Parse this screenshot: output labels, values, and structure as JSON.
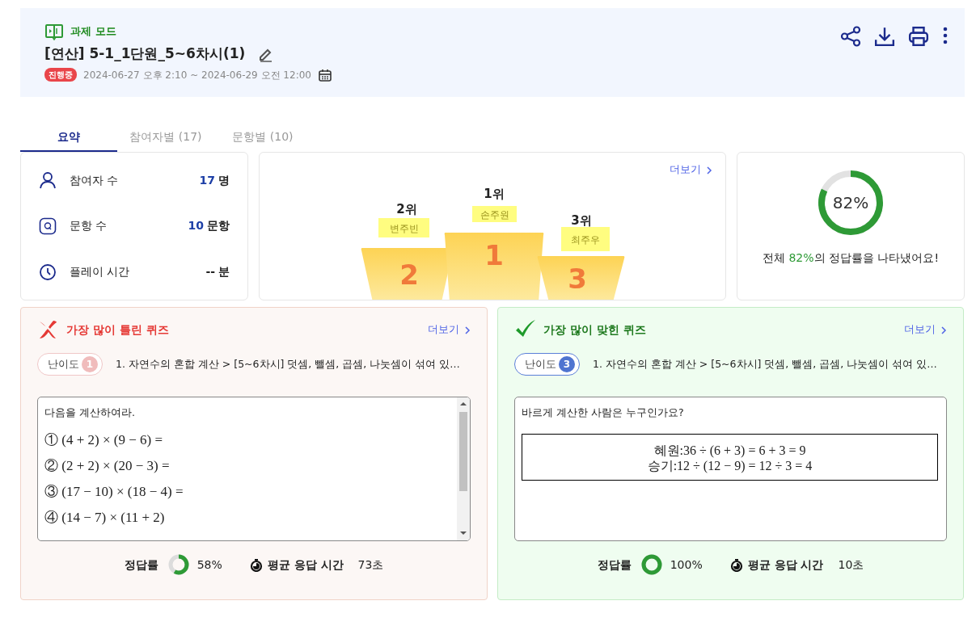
{
  "header": {
    "mode_label": "과제 모드",
    "title": "[연산] 5-1_1단원_5~6차시(1)",
    "status": "진행중",
    "period": "2024-06-27 오후 2:10 ~ 2024-06-29 오전 12:00"
  },
  "tabs": [
    {
      "label": "요약",
      "selected": true
    },
    {
      "label": "참여자별 (17)",
      "selected": false
    },
    {
      "label": "문항별 (10)",
      "selected": false
    }
  ],
  "stats": [
    {
      "kind": "participants",
      "label": "참여자 수",
      "value": "17",
      "unit": "명"
    },
    {
      "kind": "questions",
      "label": "문항 수",
      "value": "10",
      "unit": "문항"
    },
    {
      "kind": "time",
      "label": "플레이 시간",
      "value": "--",
      "unit": "분"
    }
  ],
  "podium": {
    "more_link": "더보기",
    "ranks": [
      {
        "rank_label": "2위",
        "name": "변주빈",
        "number": "2"
      },
      {
        "rank_label": "1위",
        "name": "손주원",
        "number": "1"
      },
      {
        "rank_label": "3위",
        "name": "최주우",
        "number": "3"
      }
    ]
  },
  "overall": {
    "percent": "82%",
    "level": 0.82,
    "caption_before": "전체 ",
    "caption_highlight": "82%",
    "caption_after": "의 정답률을 나타냈어요!"
  },
  "quizzes": [
    {
      "kind": "wrong",
      "title": "가장 많이 틀린 퀴즈",
      "more_link": "더보기",
      "difficulty_label": "난이도",
      "difficulty": "1",
      "path": "1. 자연수의 혼합 계산 > [5~6차시] 덧셈, 뺄셈, 곱셈, 나눗셈이 섞여 있…",
      "question": "다음을 계산하여라.",
      "lines": [
        "① (4 + 2) × (9 − 6) =",
        "② (2 + 2) × (20 − 3) =",
        "③ (17 − 10) × (18 − 4) =",
        "④ (14 − 7) × (11 + 2)"
      ],
      "accuracy_label": "정답률",
      "level": 0.58,
      "accuracy": "58%",
      "time_label": "평균 응답 시간",
      "time": "73초"
    },
    {
      "kind": "right",
      "title": "가장 많이 맞힌 퀴즈",
      "more_link": "더보기",
      "difficulty_label": "난이도",
      "difficulty": "3",
      "path": "1. 자연수의 혼합 계산 > [5~6차시] 덧셈, 뺄셈, 곱셈, 나눗셈이 섞여 있…",
      "question": "바르게 계산한 사람은 누구인가요?",
      "boxed_lines": [
        "혜원:36 ÷ (6 + 3) = 6 + 3 = 9",
        "승기:12 ÷ (12 − 9) = 12 ÷ 3 = 4"
      ],
      "accuracy_label": "정답률",
      "level": 1,
      "accuracy": "100%",
      "time_label": "평균 응답 시간",
      "time": "10초"
    }
  ]
}
